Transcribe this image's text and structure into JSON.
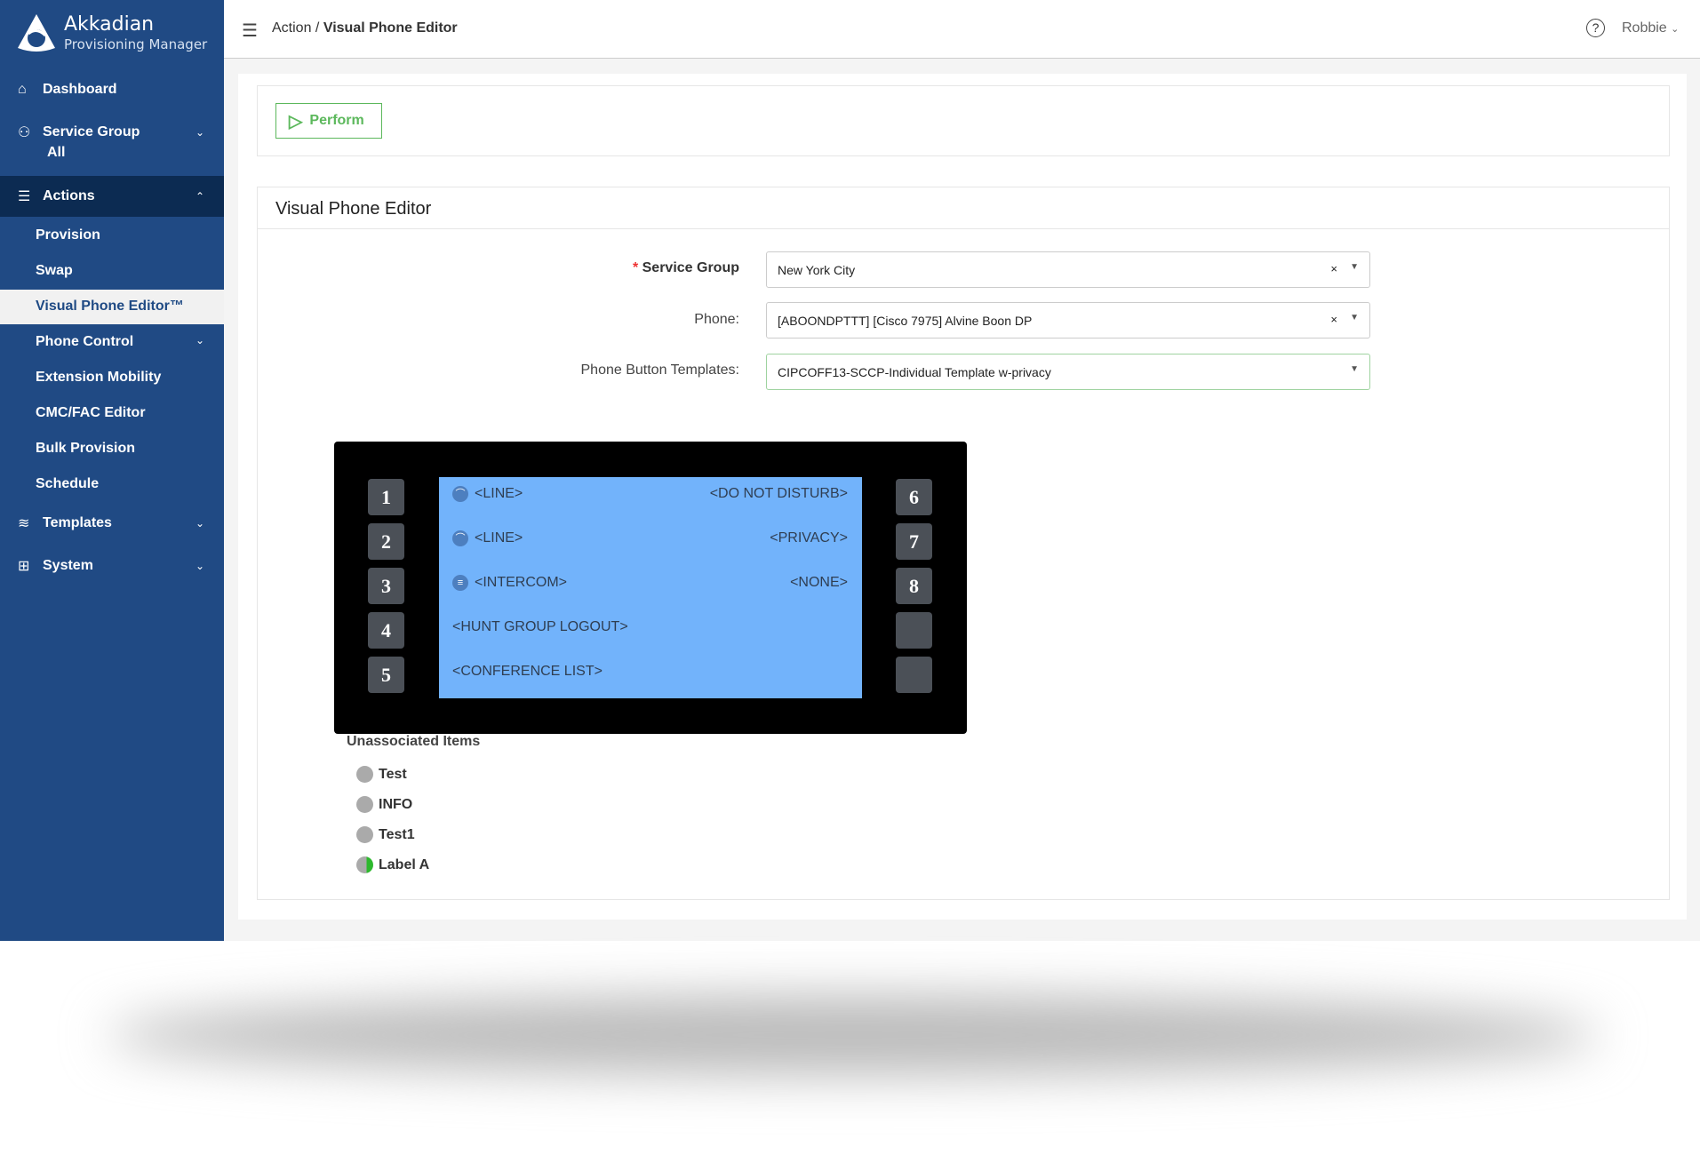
{
  "brand": {
    "name": "Akkadian",
    "subtitle": "Provisioning Manager"
  },
  "sidebar": {
    "dashboard": "Dashboard",
    "service_group": "Service Group",
    "service_group_value": "All",
    "actions": "Actions",
    "actions_items": [
      "Provision",
      "Swap",
      "Visual Phone Editor™",
      "Phone Control",
      "Extension Mobility",
      "CMC/FAC Editor",
      "Bulk Provision",
      "Schedule"
    ],
    "templates": "Templates",
    "system": "System"
  },
  "header": {
    "breadcrumb_parent": "Action /",
    "breadcrumb_current": "Visual Phone Editor",
    "user": "Robbie"
  },
  "toolbar": {
    "perform": "Perform"
  },
  "editor": {
    "title": "Visual Phone Editor",
    "required_mark": "*",
    "service_group_label": "Service Group",
    "service_group_value": "New York City",
    "phone_label": "Phone:",
    "phone_value": "[ABOONDPTTT] [Cisco 7975] Alvine Boon DP",
    "template_label": "Phone Button Templates:",
    "template_value": "CIPCOFF13-SCCP-Individual Template w-privacy"
  },
  "phone": {
    "left_buttons": [
      "1",
      "2",
      "3",
      "4",
      "5"
    ],
    "right_buttons": [
      "6",
      "7",
      "8",
      "",
      ""
    ],
    "left_labels": [
      "<LINE>",
      "<LINE>",
      "<INTERCOM>",
      "<HUNT GROUP LOGOUT>",
      "<CONFERENCE LIST>"
    ],
    "right_labels": [
      "<DO NOT DISTURB>",
      "<PRIVACY>",
      "<NONE>"
    ]
  },
  "unassociated": {
    "title": "Unassociated Items",
    "items": [
      "Test",
      "INFO",
      "Test1",
      "Label A"
    ]
  },
  "colors": {
    "sidebar": "#204a84",
    "active_band": "#0c2b52",
    "screen": "#72b3fb",
    "perform": "#5cb85c"
  }
}
